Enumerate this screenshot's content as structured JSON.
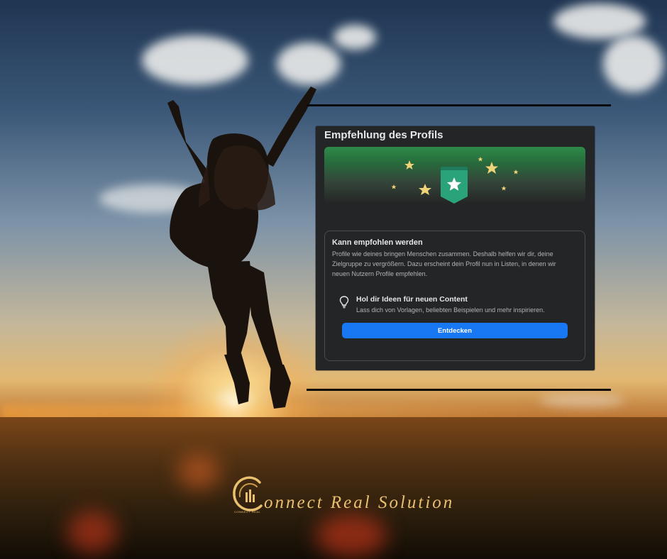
{
  "panel": {
    "title": "Empfehlung des Profils",
    "card": {
      "title": "Kann empfohlen werden",
      "description": "Profile wie deines bringen Menschen zusammen. Deshalb helfen wir dir, deine Zielgruppe zu vergrößern. Dazu erscheint dein Profil nun in Listen, in denen wir neuen Nutzern Profile empfehlen.",
      "tip": {
        "icon": "lightbulb-icon",
        "title": "Hol dir Ideen für neuen Content",
        "description": "Lass dich von Vorlagen, beliebten Beispielen und mehr inspirieren."
      },
      "button_label": "Entdecken"
    }
  },
  "branding": {
    "name": "onnect Real Solution",
    "logo_small_text": "CONNECT REAL"
  },
  "colors": {
    "panel_bg": "#242526",
    "accent_blue": "#1877f2",
    "badge_green": "#2aa37a",
    "brand_gold": "#e8c070"
  }
}
